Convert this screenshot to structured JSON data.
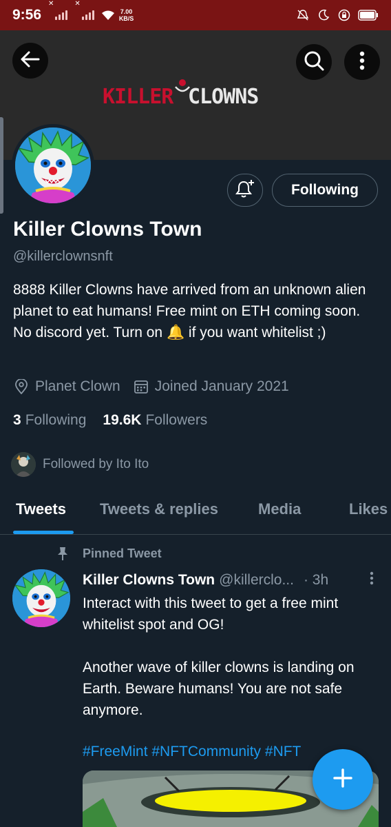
{
  "status_bar": {
    "time": "9:56",
    "speed_value": "7.00",
    "speed_unit": "KB/S"
  },
  "header": {
    "back_icon": "arrow-left-icon",
    "search_icon": "search-icon",
    "more_icon": "more-vertical-icon",
    "banner_logo_text": "KILLER CLOWNS"
  },
  "profile": {
    "name": "Killer Clowns Town",
    "handle": "@killerclownsnft",
    "bio": "8888 Killer Clowns have arrived from an unknown alien planet to eat humans! Free mint on ETH coming soon. No discord yet. Turn on 🔔 if you want whitelist ;)",
    "location": "Planet Clown",
    "joined": "Joined January 2021",
    "following_count": "3",
    "following_label": "Following",
    "followers_count": "19.6K",
    "followers_label": "Followers",
    "followed_by": "Followed by Ito Ito",
    "follow_button_label": "Following",
    "notify_icon": "bell-plus-icon"
  },
  "tabs": [
    {
      "label": "Tweets",
      "active": true
    },
    {
      "label": "Tweets & replies",
      "active": false
    },
    {
      "label": "Media",
      "active": false
    },
    {
      "label": "Likes",
      "active": false
    }
  ],
  "tweet": {
    "pinned_label": "Pinned Tweet",
    "author_name": "Killer Clowns Town",
    "author_handle": "@killerclo...",
    "time": "· 3h",
    "text_line1": "Interact with this tweet to get a free mint whitelist spot and OG!",
    "text_line2": "Another wave of killer clowns is landing on Earth. Beware humans! You are not safe anymore.",
    "hashtags": "#FreeMint #NFTCommunity #NFT"
  },
  "fab": {
    "icon": "plus-icon"
  },
  "colors": {
    "background": "#15202b",
    "accent": "#1d9bf0",
    "secondary_text": "#8b98a5",
    "status_bar": "#7a1414",
    "banner": "#2a2a2a"
  }
}
